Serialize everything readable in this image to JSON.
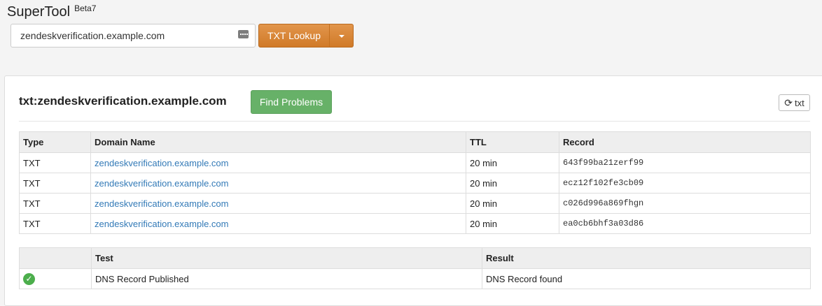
{
  "header": {
    "title": "SuperTool",
    "badge": "Beta7",
    "search": {
      "value": "zendeskverification.example.com"
    },
    "lookup_label": "TXT Lookup"
  },
  "panel": {
    "title": "txt:zendeskverification.example.com",
    "find_problems_label": "Find Problems",
    "refresh_label": "txt",
    "records": {
      "headers": [
        "Type",
        "Domain Name",
        "TTL",
        "Record"
      ],
      "rows": [
        {
          "type": "TXT",
          "domain": "zendeskverification.example.com",
          "ttl": "20 min",
          "record": "643f99ba21zerf99"
        },
        {
          "type": "TXT",
          "domain": "zendeskverification.example.com",
          "ttl": "20 min",
          "record": "ecz12f102fe3cb09"
        },
        {
          "type": "TXT",
          "domain": "zendeskverification.example.com",
          "ttl": "20 min",
          "record": "c026d996a869fhgn"
        },
        {
          "type": "TXT",
          "domain": "zendeskverification.example.com",
          "ttl": "20 min",
          "record": "ea0cb6bhf3a03d86"
        }
      ]
    },
    "results": {
      "headers": [
        "",
        "Test",
        "Result"
      ],
      "rows": [
        {
          "status_icon": "check-circle-icon",
          "test": "DNS Record Published",
          "result": "DNS Record found"
        }
      ]
    }
  },
  "colors": {
    "lookup_button": "#d9852f",
    "find_problems_button": "#67b168",
    "link": "#337ab7",
    "success": "#4cae4c"
  }
}
